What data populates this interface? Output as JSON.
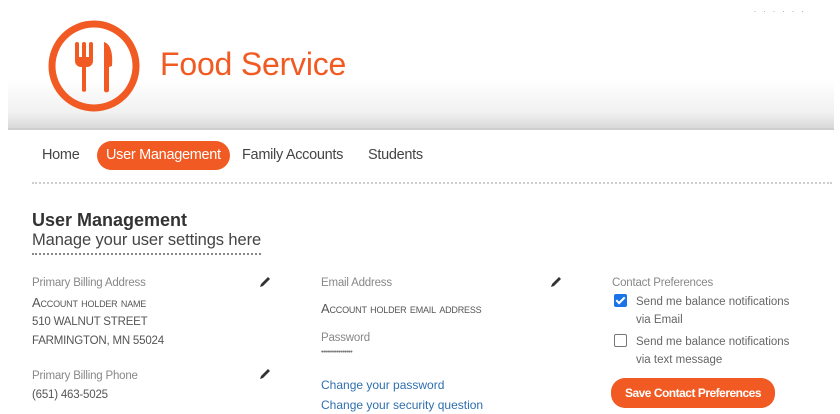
{
  "header": {
    "brand": "Food Service",
    "top_right": "·  ·  ·  ·  ·  ·"
  },
  "nav": {
    "items": [
      {
        "label": "Home",
        "active": false
      },
      {
        "label": "User Management",
        "active": true
      },
      {
        "label": "Family Accounts",
        "active": false
      },
      {
        "label": "Students",
        "active": false
      }
    ]
  },
  "page": {
    "title": "User Management",
    "subtitle": "Manage your user settings here"
  },
  "billing": {
    "address_label": "Primary Billing Address",
    "name": "Account holder name",
    "street": "510 WALNUT STREET",
    "city": "FARMINGTON, MN 55024",
    "phone_label": "Primary Billing Phone",
    "phone": "(651) 463-5025"
  },
  "account": {
    "email_label": "Email Address",
    "email": "Account holder email address",
    "password_label": "Password",
    "password_mask": "••••••••••••••••",
    "change_password": "Change your password",
    "change_security": "Change your security question"
  },
  "contact": {
    "label": "Contact Preferences",
    "options": [
      {
        "line1": "Send me balance notifications",
        "line2": "via Email",
        "checked": true
      },
      {
        "line1": "Send me balance notifications",
        "line2": "via text message",
        "checked": false
      }
    ],
    "save_label": "Save Contact Preferences"
  },
  "colors": {
    "brand": "#f15a22",
    "link": "#2f6fad",
    "checkbox_checked": "#1a73e8"
  },
  "icons": {
    "logo": "fork-knife-icon",
    "edit": "pencil-icon",
    "check": "checkmark-icon"
  }
}
